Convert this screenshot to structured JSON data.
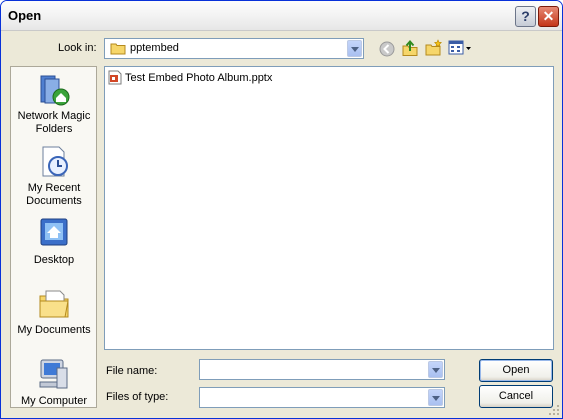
{
  "window": {
    "title": "Open"
  },
  "lookin": {
    "label": "Look in:",
    "value": "pptembed"
  },
  "places": [
    {
      "label1": "Network Magic",
      "label2": "Folders"
    },
    {
      "label1": "My Recent",
      "label2": "Documents"
    },
    {
      "label1": "Desktop",
      "label2": ""
    },
    {
      "label1": "My Documents",
      "label2": ""
    },
    {
      "label1": "My Computer",
      "label2": ""
    }
  ],
  "files": [
    {
      "name": "Test Embed Photo Album.pptx"
    }
  ],
  "filename": {
    "label": "File name:",
    "value": ""
  },
  "filetype": {
    "label": "Files of type:",
    "value": ""
  },
  "buttons": {
    "open": "Open",
    "cancel": "Cancel"
  }
}
